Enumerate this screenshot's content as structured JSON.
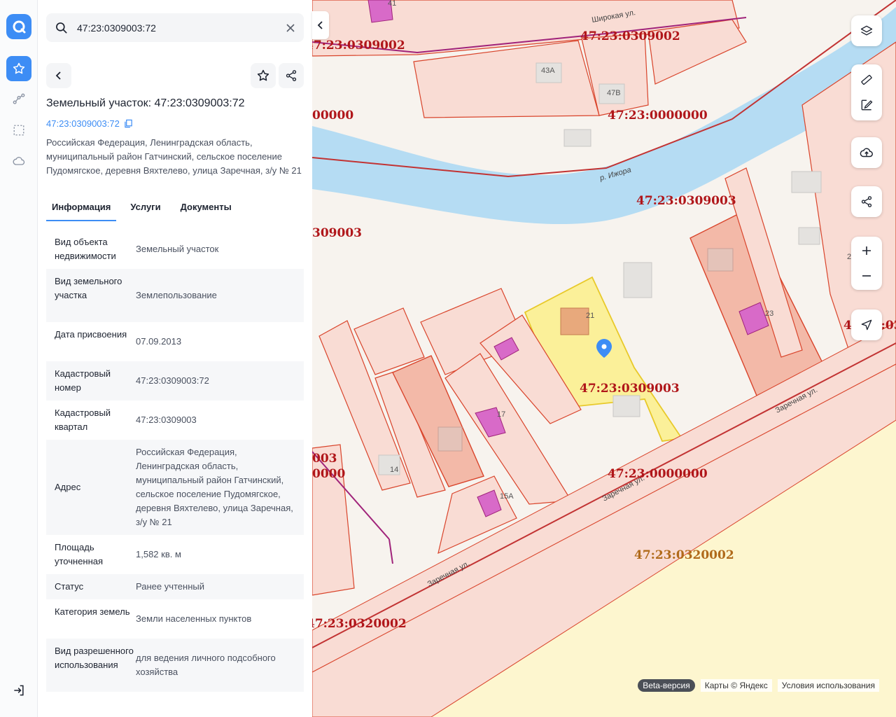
{
  "search": {
    "value": "47:23:0309003:72"
  },
  "card": {
    "title": "Земельный участок: 47:23:0309003:72",
    "cad_number": "47:23:0309003:72",
    "address": "Российская Федерация, Ленинградская область, муниципальный район Гатчинский, сельское поселение Пудомягское, деревня Вяхтелево, улица Заречная, з/у № 21"
  },
  "tabs": [
    {
      "label": "Информация",
      "active": true
    },
    {
      "label": "Услуги",
      "active": false
    },
    {
      "label": "Документы",
      "active": false
    }
  ],
  "properties": [
    {
      "key": "Вид объекта недвижимости",
      "value": "Земельный участок"
    },
    {
      "key": "Вид земельного участка",
      "value": "Землепользование"
    },
    {
      "key": "Дата присвоения",
      "value": "07.09.2013"
    },
    {
      "key": "Кадастровый номер",
      "value": "47:23:0309003:72"
    },
    {
      "key": "Кадастровый квартал",
      "value": "47:23:0309003"
    },
    {
      "key": "Адрес",
      "value": "Российская Федерация, Ленинградская область, муниципальный район Гатчинский, сельское поселение Пудомягское, деревня Вяхтелево, улица Заречная, з/у № 21"
    },
    {
      "key": "Площадь уточненная",
      "value": "1,582 кв. м"
    },
    {
      "key": "Статус",
      "value": "Ранее учтенный"
    },
    {
      "key": "Категория земель",
      "value": "Земли населенных пунктов"
    },
    {
      "key": "Вид разрешенного использования",
      "value": "для ведения личного подсобного хозяйства"
    }
  ],
  "map": {
    "labels": {
      "q1": "47:23:0309002",
      "q2": "47:23:0309002",
      "z1": "47:23:0000000",
      "z2": "00000",
      "q3": "47:23:0309003",
      "q4": "309003",
      "q5": "47:23:0309003",
      "z3": "47:23:0000000",
      "q6": "003",
      "z4": "0000",
      "q7": "47:23:0320002",
      "q8": "47:23:0320002",
      "q9": "47:23:03"
    },
    "streets": {
      "shirokaya": "Широкая ул.",
      "river": "р. Ижора",
      "zarechnaya1": "Заречная ул.",
      "zarechnaya2": "Заречная ул.",
      "zarechnaya3": "Заречная ул."
    },
    "buildings": [
      "41",
      "43А",
      "47В",
      "21",
      "23",
      "17",
      "14",
      "15А",
      "2"
    ],
    "attribution": {
      "beta": "Beta-версия",
      "maps": "Карты © Яндекс",
      "terms": "Условия использования"
    }
  },
  "colors": {
    "accent": "#3d8df5",
    "parcel_fill": "#f9dcd4",
    "parcel_stroke": "#d9442b",
    "selected": "#fbef8a",
    "water": "#b5dcf3",
    "zone_yellow": "#fdf6cf"
  }
}
